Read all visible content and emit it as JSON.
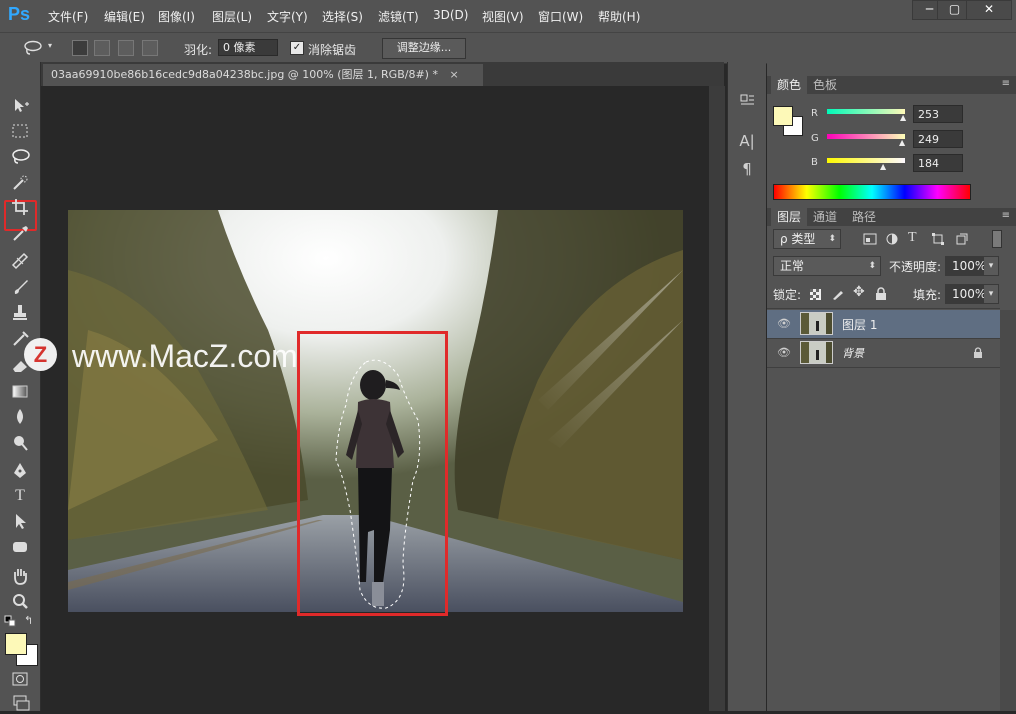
{
  "app": {
    "logo": "Ps"
  },
  "menu": {
    "items": [
      "文件(F)",
      "编辑(E)",
      "图像(I)",
      "图层(L)",
      "文字(Y)",
      "选择(S)",
      "滤镜(T)",
      "3D(D)",
      "视图(V)",
      "窗口(W)",
      "帮助(H)"
    ],
    "window_buttons": [
      "─",
      "▢",
      "✕"
    ]
  },
  "options": {
    "feather_label": "羽化:",
    "feather_value": "0 像素",
    "antialias_label": "消除锯齿",
    "antialias_checked": "✓",
    "refine_edge_label": "调整边缘..."
  },
  "document": {
    "tab_title": "03aa69910be86b16cedc9d8a04238bc.jpg @ 100% (图层 1, RGB/8#) *",
    "close_glyph": "×"
  },
  "watermark": {
    "logo_letter": "Z",
    "text": "www.MacZ.com"
  },
  "color_panel": {
    "tabs": [
      "颜色",
      "色板"
    ],
    "foreground_color": "#fdf9b8",
    "channels": [
      {
        "label": "R",
        "value": "253"
      },
      {
        "label": "G",
        "value": "249"
      },
      {
        "label": "B",
        "value": "184"
      }
    ]
  },
  "layers_panel": {
    "tabs": [
      "图层",
      "通道",
      "路径"
    ],
    "filter_label": "ρ 类型",
    "blend_mode": "正常",
    "opacity_label": "不透明度:",
    "opacity_value": "100%",
    "lock_label": "锁定:",
    "fill_label": "填充:",
    "fill_value": "100%",
    "layers": [
      {
        "name": "图层 1",
        "selected": true
      },
      {
        "name": "背景",
        "selected": false
      }
    ]
  },
  "colors": {
    "accent_highlight": "#e02a2a",
    "ps_blue": "#31a8ff",
    "selected_layer": "#5f6e82"
  }
}
